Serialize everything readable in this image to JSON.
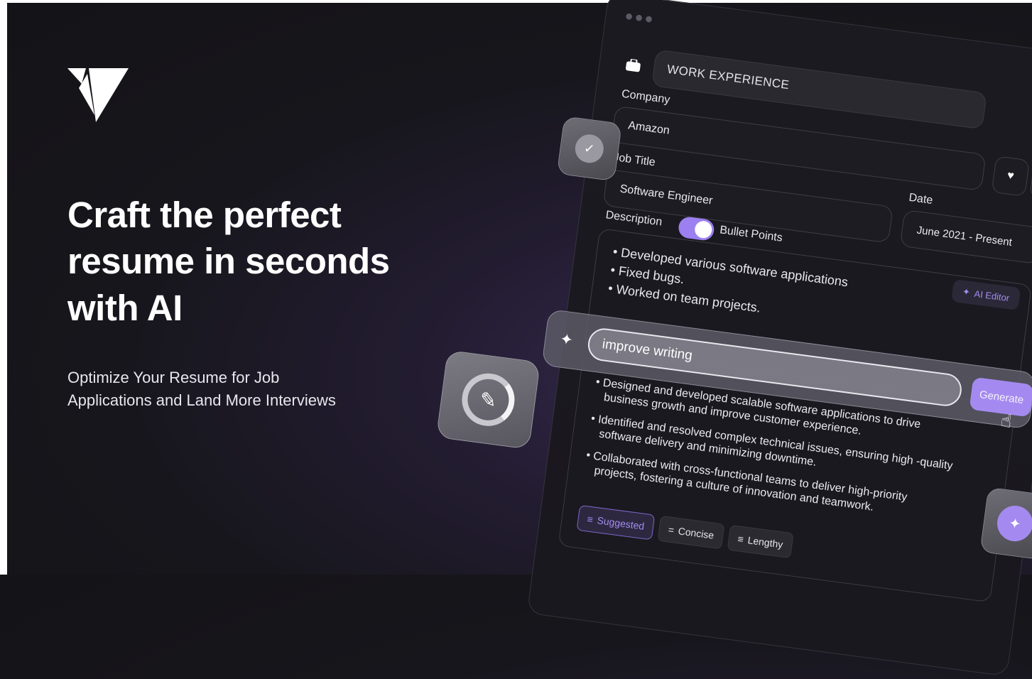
{
  "hero": {
    "headline": "Craft the perfect resume in seconds with AI",
    "subline": "Optimize Your Resume for Job Applications and Land More Interviews"
  },
  "form": {
    "section_title": "WORK EXPERIENCE",
    "company_label": "Company",
    "company_value": "Amazon",
    "job_title_label": "Job Title",
    "job_title_value": "Software Engineer",
    "date_label": "Date",
    "date_value": "June 2021 - Present",
    "description_label": "Description",
    "bullet_points_label": "Bullet Points",
    "bullet_points_on": true,
    "ai_editor_label": "AI Editor",
    "bullets": [
      "Developed various software applications",
      "Fixed bugs.",
      "Worked on team projects."
    ]
  },
  "ai": {
    "prompt_value": "improve writing",
    "generate_label": "Generate",
    "results": [
      "Designed and developed scalable software applications to drive business growth and improve customer experience.",
      "Identified and resolved complex technical issues, ensuring high -quality software delivery and minimizing downtime.",
      "Collaborated with cross-functional teams to deliver high-priority projects, fostering a culture of innovation and teamwork."
    ],
    "chips": [
      "Suggested",
      "Concise",
      "Lengthy"
    ],
    "active_chip": "Suggested"
  },
  "colors": {
    "accent": "#a48af0",
    "background": "#17161c"
  }
}
